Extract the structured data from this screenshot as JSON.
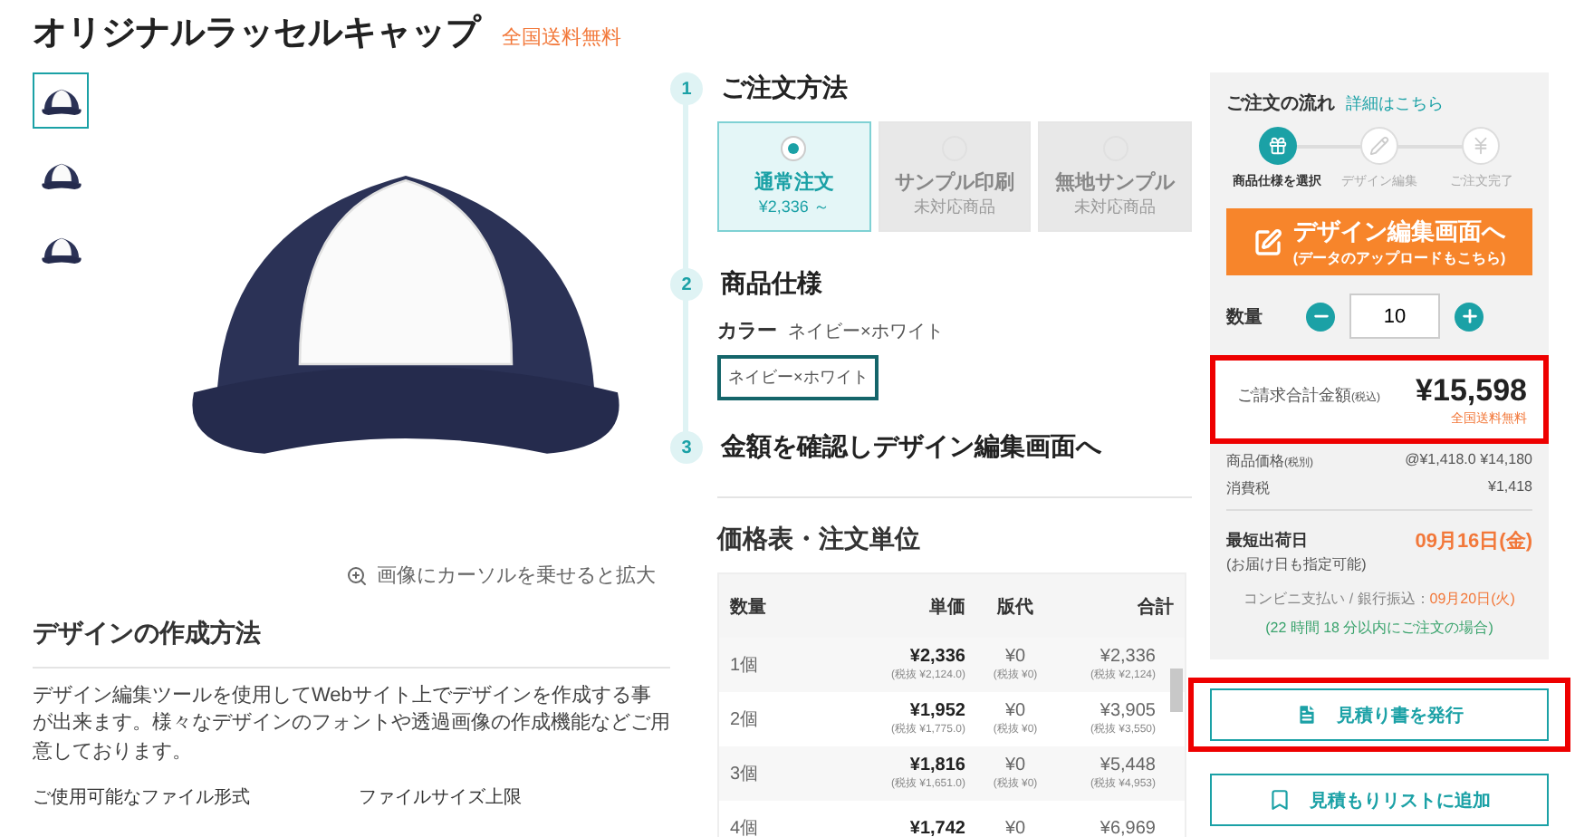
{
  "product": {
    "title": "オリジナルラッセルキャップ",
    "shipping_badge": "全国送料無料"
  },
  "thumbnails": [
    {
      "selected": true
    },
    {
      "selected": false
    },
    {
      "selected": false
    }
  ],
  "zoom_hint": "画像にカーソルを乗せると拡大",
  "design_section": {
    "heading": "デザインの作成方法",
    "body": "デザイン編集ツールを使用してWebサイト上でデザインを作成する事が出来ます。様々なデザインのフォントや透過画像の作成機能などご用意しております。",
    "labels": [
      "ご使用可能なファイル形式",
      "ファイルサイズ上限"
    ]
  },
  "steps": [
    {
      "number": "1",
      "title": "ご注文方法"
    },
    {
      "number": "2",
      "title": "商品仕様"
    },
    {
      "number": "3",
      "title": "金額を確認しデザイン編集画面へ"
    }
  ],
  "order_methods": [
    {
      "label": "通常注文",
      "sub": "¥2,336 ～",
      "selected": true,
      "disabled": false
    },
    {
      "label": "サンプル印刷",
      "sub": "未対応商品",
      "selected": false,
      "disabled": true
    },
    {
      "label": "無地サンプル",
      "sub": "未対応商品",
      "selected": false,
      "disabled": true
    }
  ],
  "color_option": {
    "label": "カラー",
    "value": "ネイビー×ホワイト",
    "swatches": [
      {
        "label": "ネイビー×ホワイト",
        "selected": true
      }
    ]
  },
  "price_table": {
    "heading": "価格表・注文単位",
    "columns": [
      "数量",
      "単価",
      "版代",
      "合計"
    ],
    "rows": [
      {
        "qty": "1個",
        "unit": "¥2,336",
        "unit_sub": "(税抜 ¥2,124.0)",
        "plate": "¥0",
        "plate_sub": "(税抜 ¥0)",
        "total": "¥2,336",
        "total_sub": "(税抜 ¥2,124)"
      },
      {
        "qty": "2個",
        "unit": "¥1,952",
        "unit_sub": "(税抜 ¥1,775.0)",
        "plate": "¥0",
        "plate_sub": "(税抜 ¥0)",
        "total": "¥3,905",
        "total_sub": "(税抜 ¥3,550)"
      },
      {
        "qty": "3個",
        "unit": "¥1,816",
        "unit_sub": "(税抜 ¥1,651.0)",
        "plate": "¥0",
        "plate_sub": "(税抜 ¥0)",
        "total": "¥5,448",
        "total_sub": "(税抜 ¥4,953)"
      },
      {
        "qty": "4個",
        "unit": "¥1,742",
        "plate": "¥0",
        "total": "¥6,969"
      }
    ]
  },
  "order_panel": {
    "flow_title": "ご注文の流れ",
    "flow_link": "詳細はこちら",
    "flow_steps": [
      {
        "label": "商品仕様を選択",
        "active": true
      },
      {
        "label": "デザイン編集",
        "active": false
      },
      {
        "label": "ご注文完了",
        "active": false
      }
    ],
    "design_button": {
      "label": "デザイン編集画面へ",
      "sub": "(データのアップロードもこちら)"
    },
    "quantity": {
      "label": "数量",
      "value": "10"
    },
    "total": {
      "label": "ご請求合計金額",
      "tax_note": "(税込)",
      "amount": "¥15,598",
      "shipping": "全国送料無料",
      "highlighted": true
    },
    "item_price": {
      "label": "商品価格",
      "tax_note": "(税別)",
      "unit": "@¥1,418.0",
      "amount": "¥14,180"
    },
    "tax": {
      "label": "消費税",
      "amount": "¥1,418"
    },
    "shipping": {
      "label": "最短出荷日",
      "date": "09月16日(金)",
      "note": "(お届け日も指定可能)",
      "alt_label": "コンビニ支払い / 銀行振込：",
      "alt_date": "09月20日(火)",
      "deadline": "(22 時間 18 分以内にご注文の場合)"
    }
  },
  "actions": [
    {
      "label": "見積り書を発行",
      "highlighted": true
    },
    {
      "label": "見積もりリストに追加",
      "highlighted": false
    }
  ]
}
